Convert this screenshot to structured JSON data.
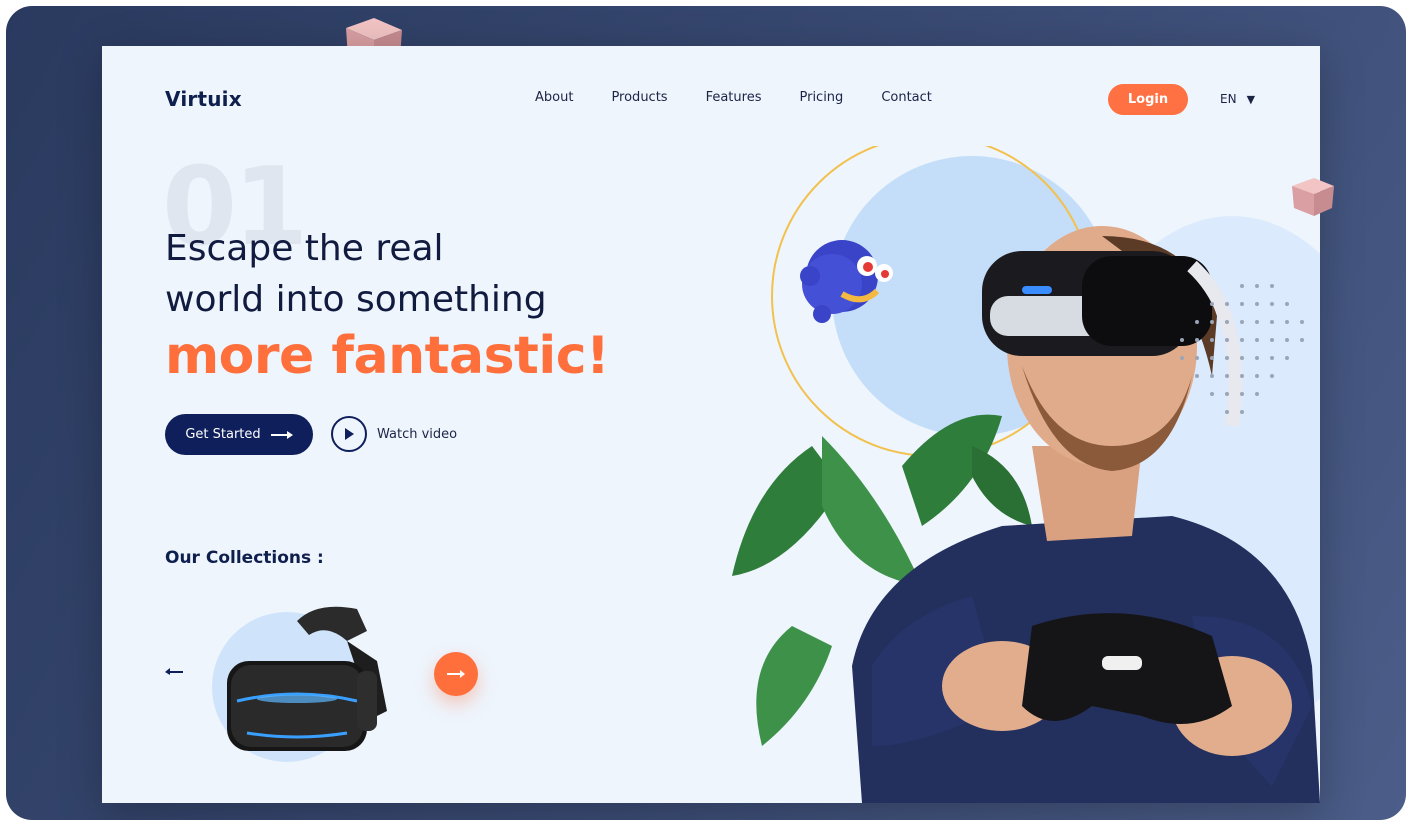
{
  "brand": {
    "logo": "Virtuix"
  },
  "nav": {
    "items": [
      "About",
      "Products",
      "Features",
      "Pricing",
      "Contact"
    ],
    "login": "Login",
    "language": "EN"
  },
  "hero": {
    "number": "01",
    "line1": "Escape the real",
    "line2": "world into something",
    "highlight": "more fantastic!",
    "primary_button": "Get Started",
    "secondary_button": "Watch video"
  },
  "collections": {
    "title": "Our Collections :"
  },
  "colors": {
    "accent": "#ff6f3c",
    "navy": "#0e1f5b",
    "background": "#eef5fd"
  }
}
